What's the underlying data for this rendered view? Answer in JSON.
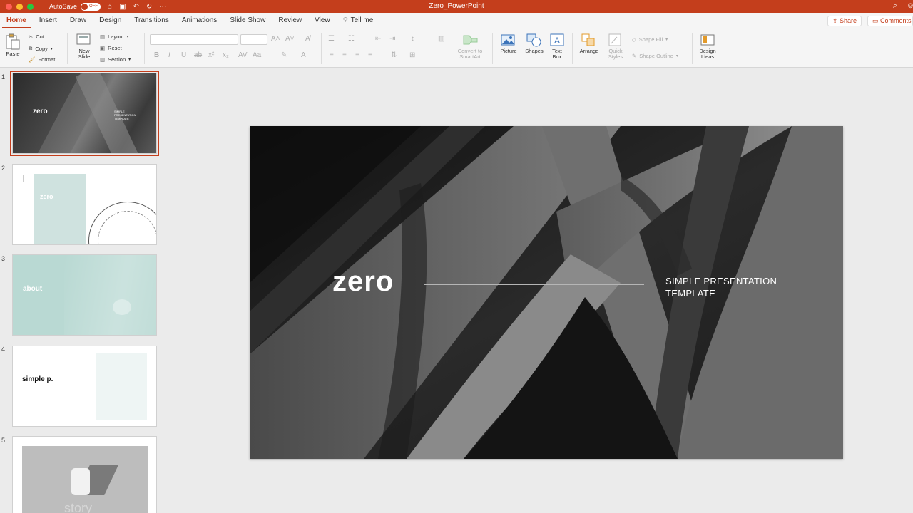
{
  "titlebar": {
    "autosave_label": "AutoSave",
    "autosave_state": "OFF",
    "doc_title": "Zero_PowerPoint"
  },
  "tabs": [
    "Home",
    "Insert",
    "Draw",
    "Design",
    "Transitions",
    "Animations",
    "Slide Show",
    "Review",
    "View"
  ],
  "tell_me": "Tell me",
  "share_label": "Share",
  "comments_label": "Comments",
  "ribbon": {
    "paste": "Paste",
    "cut": "Cut",
    "copy": "Copy",
    "format": "Format",
    "new_slide_1": "New",
    "new_slide_2": "Slide",
    "layout": "Layout",
    "reset": "Reset",
    "section": "Section",
    "convert_1": "Convert to",
    "convert_2": "SmartArt",
    "picture": "Picture",
    "shapes": "Shapes",
    "textbox_1": "Text",
    "textbox_2": "Box",
    "arrange": "Arrange",
    "quick_1": "Quick",
    "quick_2": "Styles",
    "shape_fill": "Shape Fill",
    "shape_outline": "Shape Outline",
    "design_1": "Design",
    "design_2": "Ideas"
  },
  "thumbnails": [
    {
      "num": "1",
      "title": "zero",
      "sub": "SIMPLE PRESENTATION TEMPLATE"
    },
    {
      "num": "2",
      "title": "zero"
    },
    {
      "num": "3",
      "title": "about"
    },
    {
      "num": "4",
      "title": "simple p."
    },
    {
      "num": "5",
      "title": "story"
    }
  ],
  "slide": {
    "title": "zero",
    "subtitle_1": "SIMPLE PRESENTATION",
    "subtitle_2": "TEMPLATE"
  },
  "colors": {
    "brand": "#c43e1c"
  }
}
